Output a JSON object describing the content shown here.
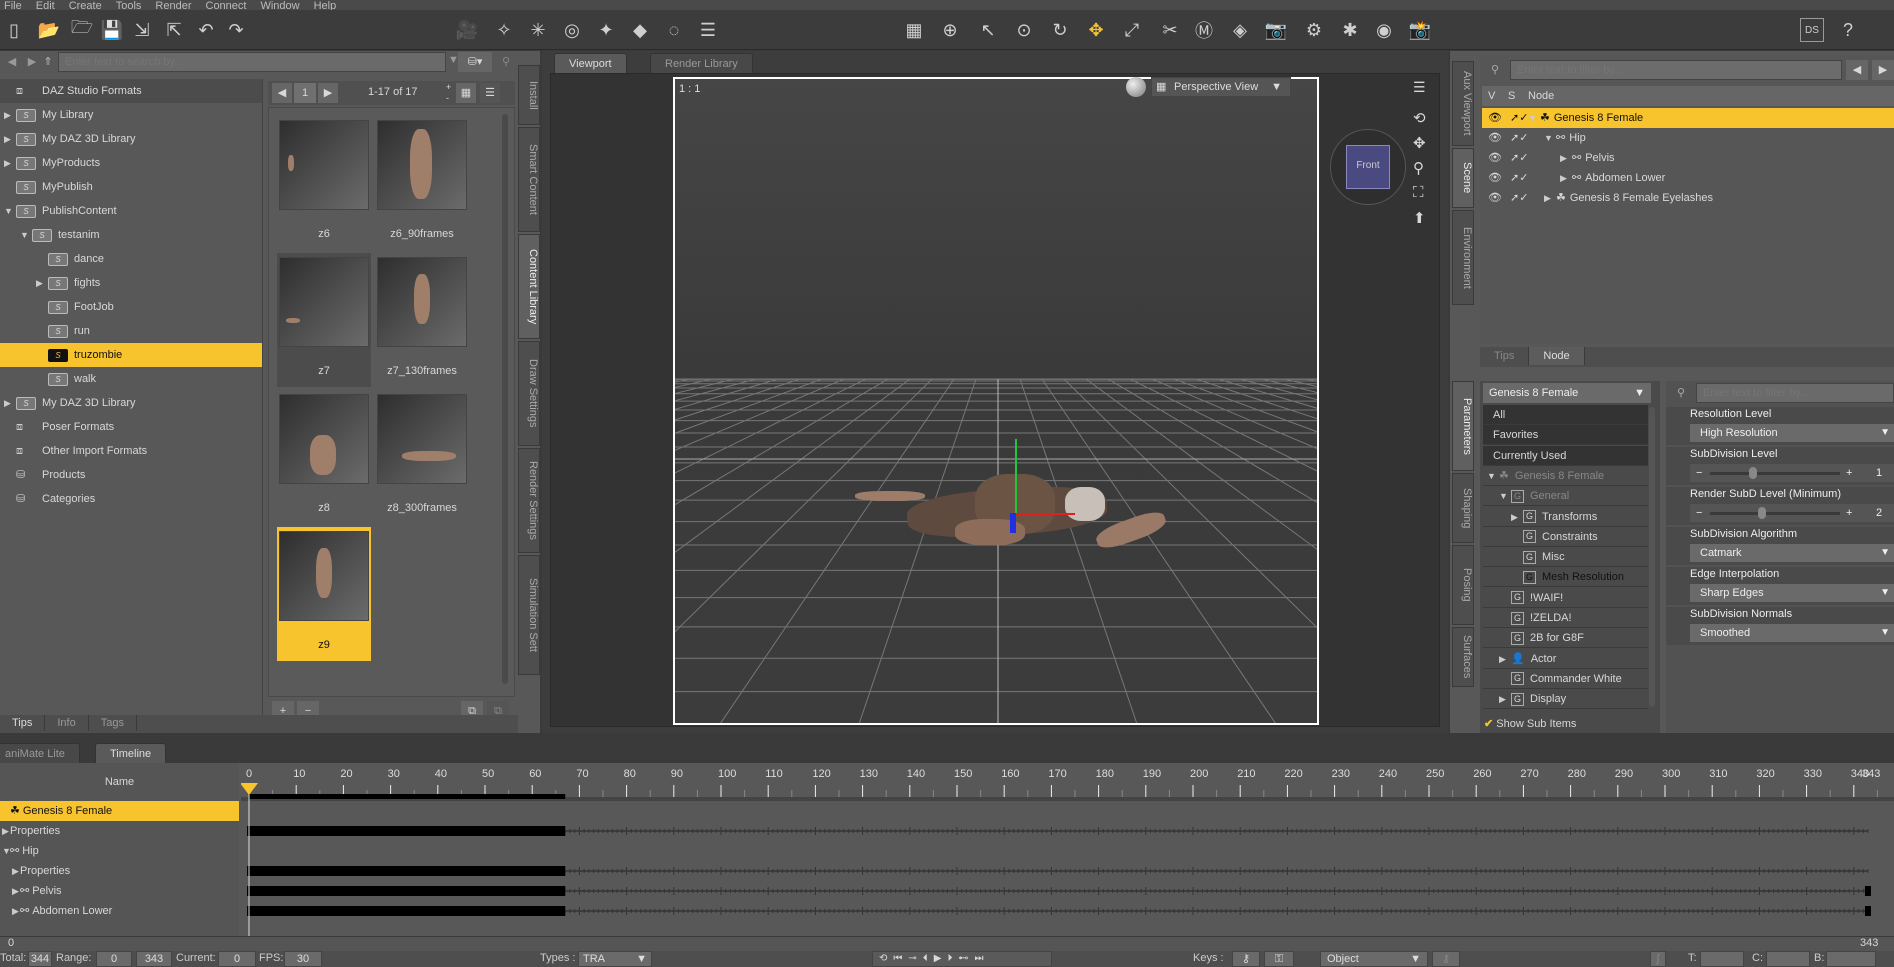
{
  "menu": [
    "File",
    "Edit",
    "Create",
    "Tools",
    "Render",
    "Connect",
    "Window",
    "Help"
  ],
  "toolbar_icons": [
    {
      "name": "new-scene-icon",
      "glyph": "▯"
    },
    {
      "name": "open-file-icon",
      "glyph": "📂"
    },
    {
      "name": "merge-file-icon",
      "glyph": "🗁"
    },
    {
      "name": "save-icon",
      "glyph": "💾"
    },
    {
      "name": "import-icon",
      "glyph": "⇲"
    },
    {
      "name": "export-icon",
      "glyph": "⇱"
    },
    {
      "name": "undo-icon",
      "glyph": "↶"
    },
    {
      "name": "redo-icon",
      "glyph": "↷"
    },
    {
      "name": "create-camera-icon",
      "glyph": "🎥"
    },
    {
      "name": "create-spotlight-icon",
      "glyph": "✧"
    },
    {
      "name": "create-pointlight-icon",
      "glyph": "✳"
    },
    {
      "name": "create-distant-light-icon",
      "glyph": "◎"
    },
    {
      "name": "create-linear-light-icon",
      "glyph": "✦"
    },
    {
      "name": "create-primitive-icon",
      "glyph": "◆"
    },
    {
      "name": "create-null-icon",
      "glyph": "◌"
    },
    {
      "name": "layout-icon",
      "glyph": "☰"
    },
    {
      "name": "universal-tool-grid-icon",
      "glyph": "▦"
    },
    {
      "name": "node-selection-icon",
      "glyph": "⊕"
    },
    {
      "name": "pointer-icon",
      "glyph": "↖"
    },
    {
      "name": "surface-selection-icon",
      "glyph": "⊙"
    },
    {
      "name": "rotate-icon",
      "glyph": "↻"
    },
    {
      "name": "translate-icon",
      "glyph": "✥",
      "active": true
    },
    {
      "name": "scale-icon",
      "glyph": "⤢"
    },
    {
      "name": "joint-editor-icon",
      "glyph": "✂"
    },
    {
      "name": "geometry-editor-icon",
      "glyph": "Ⓜ"
    },
    {
      "name": "node-weight-icon",
      "glyph": "◈"
    },
    {
      "name": "render-camera-icon",
      "glyph": "📷"
    },
    {
      "name": "render-settings-icon",
      "glyph": "⚙"
    },
    {
      "name": "iray-render-icon",
      "glyph": "✱"
    },
    {
      "name": "spot-render-icon",
      "glyph": "◉"
    },
    {
      "name": "render-icon",
      "glyph": "📸"
    }
  ],
  "toolbar_right": {
    "ds_label": "DS",
    "help": "?"
  },
  "content_library": {
    "search_placeholder": "Enter text to search by...",
    "tree": [
      {
        "label": "DAZ Studio Formats",
        "depth": 0,
        "arrow": "",
        "kind": "box",
        "header": true
      },
      {
        "label": "My Library",
        "depth": 0,
        "arrow": "▶",
        "kind": "folder"
      },
      {
        "label": "My DAZ 3D Library",
        "depth": 0,
        "arrow": "▶",
        "kind": "folder"
      },
      {
        "label": "MyProducts",
        "depth": 0,
        "arrow": "▶",
        "kind": "folder"
      },
      {
        "label": "MyPublish",
        "depth": 0,
        "arrow": "",
        "kind": "folder"
      },
      {
        "label": "PublishContent",
        "depth": 0,
        "arrow": "▼",
        "kind": "folder"
      },
      {
        "label": "testanim",
        "depth": 1,
        "arrow": "▼",
        "kind": "folder"
      },
      {
        "label": "dance",
        "depth": 2,
        "arrow": "",
        "kind": "folder"
      },
      {
        "label": "fights",
        "depth": 2,
        "arrow": "▶",
        "kind": "folder"
      },
      {
        "label": "FootJob",
        "depth": 2,
        "arrow": "",
        "kind": "folder"
      },
      {
        "label": "run",
        "depth": 2,
        "arrow": "",
        "kind": "folder"
      },
      {
        "label": "truzombie",
        "depth": 2,
        "arrow": "",
        "kind": "folder",
        "selected": true
      },
      {
        "label": "walk",
        "depth": 2,
        "arrow": "",
        "kind": "folder"
      },
      {
        "label": "My DAZ 3D Library",
        "depth": 0,
        "arrow": "▶",
        "kind": "folder"
      },
      {
        "label": "Poser Formats",
        "depth": 0,
        "arrow": "",
        "kind": "box"
      },
      {
        "label": "Other Import Formats",
        "depth": 0,
        "arrow": "",
        "kind": "box"
      },
      {
        "label": "Products",
        "depth": 0,
        "arrow": "",
        "kind": "db"
      },
      {
        "label": "Categories",
        "depth": 0,
        "arrow": "",
        "kind": "db"
      }
    ],
    "page": "1",
    "count": "1-17 of 17",
    "thumbnails": [
      {
        "label": "z6",
        "pose": "tiny"
      },
      {
        "label": "z6_90frames",
        "pose": "stand"
      },
      {
        "label": "z7",
        "pose": "lying-tiny",
        "hover": true
      },
      {
        "label": "z7_130frames",
        "pose": "stand-small"
      },
      {
        "label": "z8",
        "pose": "squat"
      },
      {
        "label": "z8_300frames",
        "pose": "lying"
      },
      {
        "label": "z9",
        "pose": "stand-small",
        "selected": true
      }
    ],
    "bottom_tabs": [
      "Tips",
      "Info",
      "Tags"
    ],
    "side_tabs": [
      {
        "label": "Install"
      },
      {
        "label": "Smart Content"
      },
      {
        "label": "Content Library",
        "active": true
      },
      {
        "label": "Draw Settings"
      },
      {
        "label": "Render Settings"
      },
      {
        "label": "Simulation Sett"
      }
    ]
  },
  "viewport": {
    "tabs": [
      {
        "label": "Viewport",
        "active": true
      },
      {
        "label": "Render Library"
      }
    ],
    "ratio": "1 : 1",
    "view_select": "Perspective View",
    "cube_label": "Front"
  },
  "scene": {
    "filter_placeholder": "Enter text to filter by...",
    "columns": [
      "V",
      "S",
      "Node"
    ],
    "nodes": [
      {
        "label": "Genesis 8 Female",
        "depth": 0,
        "arrow": "▼",
        "kind": "figure",
        "selected": true
      },
      {
        "label": "Hip",
        "depth": 1,
        "arrow": "▼",
        "kind": "bone"
      },
      {
        "label": "Pelvis",
        "depth": 2,
        "arrow": "▶",
        "kind": "bone"
      },
      {
        "label": "Abdomen Lower",
        "depth": 2,
        "arrow": "▶",
        "kind": "bone"
      },
      {
        "label": "Genesis 8 Female Eyelashes",
        "depth": 1,
        "arrow": "▶",
        "kind": "figure"
      }
    ],
    "side_tabs": [
      {
        "label": "Aux Viewport"
      },
      {
        "label": "Scene",
        "active": true
      },
      {
        "label": "Environment"
      }
    ],
    "bottom_tabs": [
      {
        "label": "Tips"
      },
      {
        "label": "Node",
        "active": true
      }
    ]
  },
  "parameters": {
    "node_select": "Genesis 8 Female",
    "filter_placeholder": "Enter text to filter by...",
    "list": [
      {
        "label": "All",
        "depth": 0,
        "kind": "plain",
        "dark": true
      },
      {
        "label": "Favorites",
        "depth": 0,
        "kind": "plain",
        "dark": true
      },
      {
        "label": "Currently Used",
        "depth": 0,
        "kind": "plain",
        "dark": true
      },
      {
        "label": "Genesis 8 Female",
        "depth": 0,
        "arrow": "▼",
        "kind": "figure",
        "dim": true
      },
      {
        "label": "General",
        "depth": 1,
        "arrow": "▼",
        "kind": "group",
        "dim": true
      },
      {
        "label": "Transforms",
        "depth": 2,
        "arrow": "▶",
        "kind": "group"
      },
      {
        "label": "Constraints",
        "depth": 2,
        "kind": "group"
      },
      {
        "label": "Misc",
        "depth": 2,
        "kind": "group"
      },
      {
        "label": "Mesh Resolution",
        "depth": 2,
        "kind": "group",
        "selected": true
      },
      {
        "label": "!WAIF!",
        "depth": 1,
        "kind": "group"
      },
      {
        "label": "!ZELDA!",
        "depth": 1,
        "kind": "group"
      },
      {
        "label": "2B for G8F",
        "depth": 1,
        "kind": "group"
      },
      {
        "label": "Actor",
        "depth": 1,
        "arrow": "▶",
        "kind": "actor"
      },
      {
        "label": "Commander White",
        "depth": 1,
        "kind": "group"
      },
      {
        "label": "Display",
        "depth": 1,
        "arrow": "▶",
        "kind": "group"
      }
    ],
    "show_sub_items": "Show Sub Items",
    "properties": [
      {
        "title": "Resolution Level",
        "type": "select",
        "value": "High Resolution"
      },
      {
        "title": "SubDivision Level",
        "type": "slider",
        "value": "1",
        "fraction": 0.33
      },
      {
        "title": "Render SubD Level (Minimum)",
        "type": "slider",
        "value": "2",
        "fraction": 0.4
      },
      {
        "title": "SubDivision Algorithm",
        "type": "select",
        "value": "Catmark"
      },
      {
        "title": "Edge Interpolation",
        "type": "select",
        "value": "Sharp Edges"
      },
      {
        "title": "SubDivision Normals",
        "type": "select",
        "value": "Smoothed"
      }
    ],
    "side_tabs": [
      {
        "label": "Parameters",
        "active": true
      },
      {
        "label": "Shaping"
      },
      {
        "label": "Posing"
      },
      {
        "label": "Surfaces"
      }
    ]
  },
  "timeline": {
    "tabs": [
      {
        "label": "aniMate Lite"
      },
      {
        "label": "Timeline",
        "active": true
      }
    ],
    "name_header": "Name",
    "ruler_labels": [
      "0",
      "10",
      "20",
      "30",
      "40",
      "50",
      "60",
      "70",
      "80",
      "90",
      "100",
      "110",
      "120",
      "130",
      "140",
      "150",
      "160",
      "170",
      "180",
      "190",
      "200",
      "210",
      "220",
      "230",
      "240",
      "250",
      "260",
      "270",
      "280",
      "290",
      "300",
      "310",
      "320",
      "330",
      "340"
    ],
    "end_label": "343",
    "current_frame": 0,
    "total_frames": 343,
    "key_end_frame": 67,
    "rows": [
      {
        "label": "Genesis 8 Female",
        "depth": 0,
        "arrow": "",
        "kind": "figure",
        "selected": true,
        "keys": false
      },
      {
        "label": "Properties",
        "depth": 0,
        "arrow": "▶",
        "kind": "none",
        "keys": true
      },
      {
        "label": "Hip",
        "depth": 0,
        "arrow": "▼",
        "kind": "bone",
        "keys": false
      },
      {
        "label": "Properties",
        "depth": 1,
        "arrow": "▶",
        "kind": "none",
        "keys": true
      },
      {
        "label": "Pelvis",
        "depth": 1,
        "arrow": "▶",
        "kind": "bone",
        "keys": true,
        "end_key": true
      },
      {
        "label": "Abdomen Lower",
        "depth": 1,
        "arrow": "▶",
        "kind": "bone",
        "keys": true,
        "end_key": true
      }
    ],
    "range_start_label": "0",
    "range_end_label": "343"
  },
  "status": {
    "total_label": "Total:",
    "total": "344",
    "range_label": "Range:",
    "range_start": "0",
    "range_end": "343",
    "current_label": "Current:",
    "current": "0",
    "fps_label": "FPS:",
    "fps": "30",
    "types_label": "Types :",
    "types_value": "TRA",
    "keys_label": "Keys :",
    "keys_mode": "Object",
    "t_label": "T:",
    "c_label": "C:",
    "b_label": "B:"
  },
  "colors": {
    "accent": "#f7c42e",
    "panel": "#585858",
    "dark": "#3c3c3c"
  }
}
